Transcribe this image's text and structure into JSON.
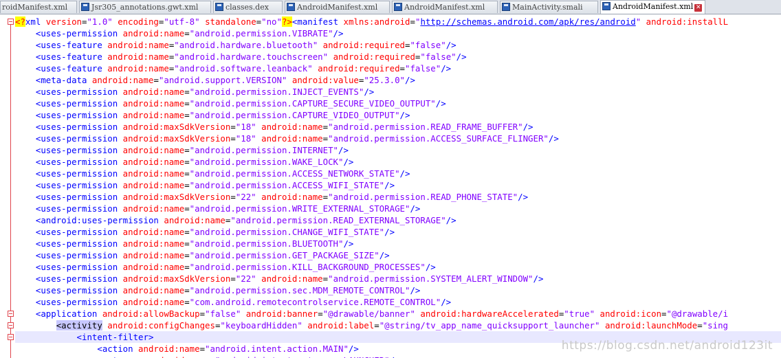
{
  "tabs": [
    {
      "label": "roidManifest.xml",
      "active": false
    },
    {
      "label": "Jsr305_annotations.gwt.xml",
      "active": false
    },
    {
      "label": "classes.dex",
      "active": false
    },
    {
      "label": "AndroidManifest.xml",
      "active": false
    },
    {
      "label": "AndroidManifest.xml",
      "active": false
    },
    {
      "label": "MainActivity.smali",
      "active": false
    },
    {
      "label": "AndroidManifest.xml",
      "active": true
    }
  ],
  "code_lines": [
    [
      [
        "pi",
        "<?"
      ],
      [
        "tag",
        "xml "
      ],
      [
        "attr",
        "version"
      ],
      [
        "plain",
        "="
      ],
      [
        "val",
        "\"1.0\" "
      ],
      [
        "attr",
        "encoding"
      ],
      [
        "plain",
        "="
      ],
      [
        "val",
        "\"utf-8\" "
      ],
      [
        "attr",
        "standalone"
      ],
      [
        "plain",
        "="
      ],
      [
        "val",
        "\"no\""
      ],
      [
        "pi",
        "?>"
      ],
      [
        "brk",
        "<"
      ],
      [
        "tag",
        "manifest "
      ],
      [
        "attr",
        "xmlns:android"
      ],
      [
        "plain",
        "="
      ],
      [
        "val",
        "\""
      ],
      [
        "url",
        "http://schemas.android.com/apk/res/android"
      ],
      [
        "val",
        "\" "
      ],
      [
        "attr",
        "android:installL"
      ]
    ],
    [
      [
        "plain",
        "    "
      ],
      [
        "brk",
        "<"
      ],
      [
        "tag",
        "uses-permission "
      ],
      [
        "attr",
        "android:name"
      ],
      [
        "plain",
        "="
      ],
      [
        "val",
        "\"android.permission.VIBRATE\""
      ],
      [
        "brk",
        "/>"
      ]
    ],
    [
      [
        "plain",
        "    "
      ],
      [
        "brk",
        "<"
      ],
      [
        "tag",
        "uses-feature "
      ],
      [
        "attr",
        "android:name"
      ],
      [
        "plain",
        "="
      ],
      [
        "val",
        "\"android.hardware.bluetooth\" "
      ],
      [
        "attr",
        "android:required"
      ],
      [
        "plain",
        "="
      ],
      [
        "val",
        "\"false\""
      ],
      [
        "brk",
        "/>"
      ]
    ],
    [
      [
        "plain",
        "    "
      ],
      [
        "brk",
        "<"
      ],
      [
        "tag",
        "uses-feature "
      ],
      [
        "attr",
        "android:name"
      ],
      [
        "plain",
        "="
      ],
      [
        "val",
        "\"android.hardware.touchscreen\" "
      ],
      [
        "attr",
        "android:required"
      ],
      [
        "plain",
        "="
      ],
      [
        "val",
        "\"false\""
      ],
      [
        "brk",
        "/>"
      ]
    ],
    [
      [
        "plain",
        "    "
      ],
      [
        "brk",
        "<"
      ],
      [
        "tag",
        "uses-feature "
      ],
      [
        "attr",
        "android:name"
      ],
      [
        "plain",
        "="
      ],
      [
        "val",
        "\"android.software.leanback\" "
      ],
      [
        "attr",
        "android:required"
      ],
      [
        "plain",
        "="
      ],
      [
        "val",
        "\"false\""
      ],
      [
        "brk",
        "/>"
      ]
    ],
    [
      [
        "plain",
        "    "
      ],
      [
        "brk",
        "<"
      ],
      [
        "tag",
        "meta-data "
      ],
      [
        "attr",
        "android:name"
      ],
      [
        "plain",
        "="
      ],
      [
        "val",
        "\"android.support.VERSION\" "
      ],
      [
        "attr",
        "android:value"
      ],
      [
        "plain",
        "="
      ],
      [
        "val",
        "\"25.3.0\""
      ],
      [
        "brk",
        "/>"
      ]
    ],
    [
      [
        "plain",
        "    "
      ],
      [
        "brk",
        "<"
      ],
      [
        "tag",
        "uses-permission "
      ],
      [
        "attr",
        "android:name"
      ],
      [
        "plain",
        "="
      ],
      [
        "val",
        "\"android.permission.INJECT_EVENTS\""
      ],
      [
        "brk",
        "/>"
      ]
    ],
    [
      [
        "plain",
        "    "
      ],
      [
        "brk",
        "<"
      ],
      [
        "tag",
        "uses-permission "
      ],
      [
        "attr",
        "android:name"
      ],
      [
        "plain",
        "="
      ],
      [
        "val",
        "\"android.permission.CAPTURE_SECURE_VIDEO_OUTPUT\""
      ],
      [
        "brk",
        "/>"
      ]
    ],
    [
      [
        "plain",
        "    "
      ],
      [
        "brk",
        "<"
      ],
      [
        "tag",
        "uses-permission "
      ],
      [
        "attr",
        "android:name"
      ],
      [
        "plain",
        "="
      ],
      [
        "val",
        "\"android.permission.CAPTURE_VIDEO_OUTPUT\""
      ],
      [
        "brk",
        "/>"
      ]
    ],
    [
      [
        "plain",
        "    "
      ],
      [
        "brk",
        "<"
      ],
      [
        "tag",
        "uses-permission "
      ],
      [
        "attr",
        "android:maxSdkVersion"
      ],
      [
        "plain",
        "="
      ],
      [
        "val",
        "\"18\" "
      ],
      [
        "attr",
        "android:name"
      ],
      [
        "plain",
        "="
      ],
      [
        "val",
        "\"android.permission.READ_FRAME_BUFFER\""
      ],
      [
        "brk",
        "/>"
      ]
    ],
    [
      [
        "plain",
        "    "
      ],
      [
        "brk",
        "<"
      ],
      [
        "tag",
        "uses-permission "
      ],
      [
        "attr",
        "android:maxSdkVersion"
      ],
      [
        "plain",
        "="
      ],
      [
        "val",
        "\"18\" "
      ],
      [
        "attr",
        "android:name"
      ],
      [
        "plain",
        "="
      ],
      [
        "val",
        "\"android.permission.ACCESS_SURFACE_FLINGER\""
      ],
      [
        "brk",
        "/>"
      ]
    ],
    [
      [
        "plain",
        "    "
      ],
      [
        "brk",
        "<"
      ],
      [
        "tag",
        "uses-permission "
      ],
      [
        "attr",
        "android:name"
      ],
      [
        "plain",
        "="
      ],
      [
        "val",
        "\"android.permission.INTERNET\""
      ],
      [
        "brk",
        "/>"
      ]
    ],
    [
      [
        "plain",
        "    "
      ],
      [
        "brk",
        "<"
      ],
      [
        "tag",
        "uses-permission "
      ],
      [
        "attr",
        "android:name"
      ],
      [
        "plain",
        "="
      ],
      [
        "val",
        "\"android.permission.WAKE_LOCK\""
      ],
      [
        "brk",
        "/>"
      ]
    ],
    [
      [
        "plain",
        "    "
      ],
      [
        "brk",
        "<"
      ],
      [
        "tag",
        "uses-permission "
      ],
      [
        "attr",
        "android:name"
      ],
      [
        "plain",
        "="
      ],
      [
        "val",
        "\"android.permission.ACCESS_NETWORK_STATE\""
      ],
      [
        "brk",
        "/>"
      ]
    ],
    [
      [
        "plain",
        "    "
      ],
      [
        "brk",
        "<"
      ],
      [
        "tag",
        "uses-permission "
      ],
      [
        "attr",
        "android:name"
      ],
      [
        "plain",
        "="
      ],
      [
        "val",
        "\"android.permission.ACCESS_WIFI_STATE\""
      ],
      [
        "brk",
        "/>"
      ]
    ],
    [
      [
        "plain",
        "    "
      ],
      [
        "brk",
        "<"
      ],
      [
        "tag",
        "uses-permission "
      ],
      [
        "attr",
        "android:maxSdkVersion"
      ],
      [
        "plain",
        "="
      ],
      [
        "val",
        "\"22\" "
      ],
      [
        "attr",
        "android:name"
      ],
      [
        "plain",
        "="
      ],
      [
        "val",
        "\"android.permission.READ_PHONE_STATE\""
      ],
      [
        "brk",
        "/>"
      ]
    ],
    [
      [
        "plain",
        "    "
      ],
      [
        "brk",
        "<"
      ],
      [
        "tag",
        "uses-permission "
      ],
      [
        "attr",
        "android:name"
      ],
      [
        "plain",
        "="
      ],
      [
        "val",
        "\"android.permission.WRITE_EXTERNAL_STORAGE\""
      ],
      [
        "brk",
        "/>"
      ]
    ],
    [
      [
        "plain",
        "    "
      ],
      [
        "brk",
        "<"
      ],
      [
        "tag",
        "android:uses-permission "
      ],
      [
        "attr",
        "android:name"
      ],
      [
        "plain",
        "="
      ],
      [
        "val",
        "\"android.permission.READ_EXTERNAL_STORAGE\""
      ],
      [
        "brk",
        "/>"
      ]
    ],
    [
      [
        "plain",
        "    "
      ],
      [
        "brk",
        "<"
      ],
      [
        "tag",
        "uses-permission "
      ],
      [
        "attr",
        "android:name"
      ],
      [
        "plain",
        "="
      ],
      [
        "val",
        "\"android.permission.CHANGE_WIFI_STATE\""
      ],
      [
        "brk",
        "/>"
      ]
    ],
    [
      [
        "plain",
        "    "
      ],
      [
        "brk",
        "<"
      ],
      [
        "tag",
        "uses-permission "
      ],
      [
        "attr",
        "android:name"
      ],
      [
        "plain",
        "="
      ],
      [
        "val",
        "\"android.permission.BLUETOOTH\""
      ],
      [
        "brk",
        "/>"
      ]
    ],
    [
      [
        "plain",
        "    "
      ],
      [
        "brk",
        "<"
      ],
      [
        "tag",
        "uses-permission "
      ],
      [
        "attr",
        "android:name"
      ],
      [
        "plain",
        "="
      ],
      [
        "val",
        "\"android.permission.GET_PACKAGE_SIZE\""
      ],
      [
        "brk",
        "/>"
      ]
    ],
    [
      [
        "plain",
        "    "
      ],
      [
        "brk",
        "<"
      ],
      [
        "tag",
        "uses-permission "
      ],
      [
        "attr",
        "android:name"
      ],
      [
        "plain",
        "="
      ],
      [
        "val",
        "\"android.permission.KILL_BACKGROUND_PROCESSES\""
      ],
      [
        "brk",
        "/>"
      ]
    ],
    [
      [
        "plain",
        "    "
      ],
      [
        "brk",
        "<"
      ],
      [
        "tag",
        "uses-permission "
      ],
      [
        "attr",
        "android:maxSdkVersion"
      ],
      [
        "plain",
        "="
      ],
      [
        "val",
        "\"22\" "
      ],
      [
        "attr",
        "android:name"
      ],
      [
        "plain",
        "="
      ],
      [
        "val",
        "\"android.permission.SYSTEM_ALERT_WINDOW\""
      ],
      [
        "brk",
        "/>"
      ]
    ],
    [
      [
        "plain",
        "    "
      ],
      [
        "brk",
        "<"
      ],
      [
        "tag",
        "uses-permission "
      ],
      [
        "attr",
        "android:name"
      ],
      [
        "plain",
        "="
      ],
      [
        "val",
        "\"android.permission.sec.MDM_REMOTE_CONTROL\""
      ],
      [
        "brk",
        "/>"
      ]
    ],
    [
      [
        "plain",
        "    "
      ],
      [
        "brk",
        "<"
      ],
      [
        "tag",
        "uses-permission "
      ],
      [
        "attr",
        "android:name"
      ],
      [
        "plain",
        "="
      ],
      [
        "val",
        "\"com.android.remotecontrolservice.REMOTE_CONTROL\""
      ],
      [
        "brk",
        "/>"
      ]
    ],
    [
      [
        "plain",
        "    "
      ],
      [
        "brk",
        "<"
      ],
      [
        "tag",
        "application "
      ],
      [
        "attr",
        "android:allowBackup"
      ],
      [
        "plain",
        "="
      ],
      [
        "val",
        "\"false\" "
      ],
      [
        "attr",
        "android:banner"
      ],
      [
        "plain",
        "="
      ],
      [
        "val",
        "\"@drawable/banner\" "
      ],
      [
        "attr",
        "android:hardwareAccelerated"
      ],
      [
        "plain",
        "="
      ],
      [
        "val",
        "\"true\" "
      ],
      [
        "attr",
        "android:icon"
      ],
      [
        "plain",
        "="
      ],
      [
        "val",
        "\"@drawable/i"
      ]
    ],
    [
      [
        "plain",
        "        "
      ],
      [
        "match",
        "<activity"
      ],
      [
        "plain",
        " "
      ],
      [
        "attr",
        "android:configChanges"
      ],
      [
        "plain",
        "="
      ],
      [
        "val",
        "\"keyboardHidden\" "
      ],
      [
        "attr",
        "android:label"
      ],
      [
        "plain",
        "="
      ],
      [
        "val",
        "\"@string/tv_app_name_quicksupport_launcher\" "
      ],
      [
        "attr",
        "android:launchMode"
      ],
      [
        "plain",
        "="
      ],
      [
        "val",
        "\"sing"
      ]
    ],
    [
      [
        "plain",
        "            "
      ],
      [
        "brk",
        "<"
      ],
      [
        "tag",
        "intent-filter"
      ],
      [
        "brk",
        ">"
      ]
    ],
    [
      [
        "plain",
        "                "
      ],
      [
        "brk",
        "<"
      ],
      [
        "tag",
        "action "
      ],
      [
        "attr",
        "android:name"
      ],
      [
        "plain",
        "="
      ],
      [
        "val",
        "\"android.intent.action.MAIN\""
      ],
      [
        "brk",
        "/>"
      ]
    ],
    [
      [
        "plain",
        "                "
      ],
      [
        "brk",
        "<"
      ],
      [
        "tag",
        "category "
      ],
      [
        "attr",
        "android:name"
      ],
      [
        "plain",
        "="
      ],
      [
        "val",
        "\"android.intent.category.LAUNCHER\""
      ],
      [
        "brk",
        "/>"
      ]
    ]
  ],
  "highlighted_line": 27,
  "watermark": "https://blog.csdn.net/android123it",
  "colors": {
    "tag": "#0000ff",
    "attr": "#ff0000",
    "value": "#8000ff",
    "fold": "#e0444c"
  },
  "icons": [
    "save-icon",
    "close-icon",
    "fold-icon"
  ]
}
